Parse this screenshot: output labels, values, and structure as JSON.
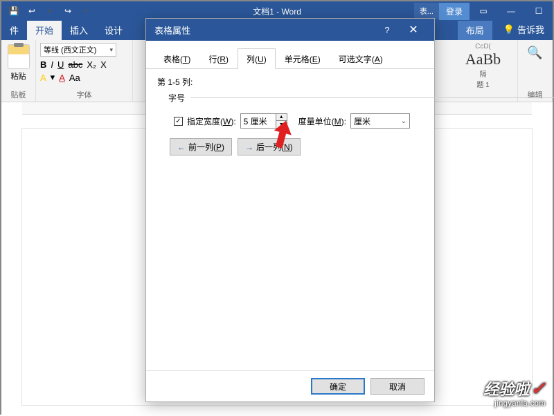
{
  "titlebar": {
    "doc_title": "文档1 - Word",
    "tools_label": "表...",
    "login_label": "登录"
  },
  "ribbon_tabs": {
    "file": "件",
    "home": "开始",
    "insert": "插入",
    "design": "设计",
    "layout": "布局",
    "tell_me": "告诉我"
  },
  "ribbon": {
    "clipboard": {
      "paste": "粘贴",
      "group": "贴板"
    },
    "font": {
      "name": "等线 (西文正文)",
      "group": "字体",
      "bold": "B",
      "italic": "I",
      "underline": "U",
      "strike": "abc",
      "sub": "X₂",
      "sup": "X",
      "a1": "A",
      "a2": "A",
      "aa": "Aa"
    },
    "styles": {
      "preview": "AaBb",
      "label1": "CcD(",
      "label2": "隔",
      "label3": "题 1"
    },
    "edit": {
      "label": "编辑"
    }
  },
  "dialog": {
    "title": "表格属性",
    "tabs": {
      "table": {
        "label": "表格(",
        "key": "T",
        "suffix": ")"
      },
      "row": {
        "label": "行(",
        "key": "R",
        "suffix": ")"
      },
      "column": {
        "label": "列(",
        "key": "U",
        "suffix": ")"
      },
      "cell": {
        "label": "单元格(",
        "key": "E",
        "suffix": ")"
      },
      "alttext": {
        "label": "可选文字(",
        "key": "A",
        "suffix": ")"
      }
    },
    "column_panel": {
      "heading": "第 1-5 列:",
      "size_label": "字号",
      "width_checkbox": "指定宽度(",
      "width_key": "W",
      "width_suffix": "):",
      "width_value": "5 厘米",
      "unit_label": "度量单位(",
      "unit_key": "M",
      "unit_suffix": "):",
      "unit_value": "厘米",
      "prev_col": "前一列(",
      "prev_key": "P",
      "prev_suffix": ")",
      "next_col": "后一列(",
      "next_key": "N",
      "next_suffix": ")"
    },
    "buttons": {
      "ok": "确定",
      "cancel": "取消"
    }
  },
  "watermark": {
    "main": "经验啦",
    "sub": "jingyanla.com"
  }
}
